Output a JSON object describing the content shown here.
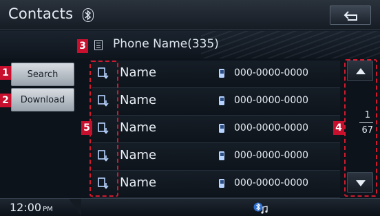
{
  "header": {
    "title": "Contacts",
    "back_label": "back"
  },
  "subbar": {
    "phone_name": "Phone Name(335)"
  },
  "badges": [
    "1",
    "2",
    "3",
    "4",
    "5"
  ],
  "side_buttons": {
    "search": "Search",
    "download": "Download"
  },
  "contacts": [
    {
      "name": "Name",
      "number": "000-0000-0000"
    },
    {
      "name": "Name",
      "number": "000-0000-0000"
    },
    {
      "name": "Name",
      "number": "000-0000-0000"
    },
    {
      "name": "Name",
      "number": "000-0000-0000"
    },
    {
      "name": "Name",
      "number": "000-0000-0000"
    }
  ],
  "pagination": {
    "current": "1",
    "total": "67"
  },
  "footer": {
    "time": "12:00",
    "ampm": "PM"
  },
  "icons": {
    "bluetooth": "bluetooth-icon",
    "back": "back-arrow-icon",
    "phonebook": "phonebook-icon",
    "download_contact": "contact-download-icon",
    "mobile": "mobile-phone-icon",
    "scroll_up": "triangle-up-icon",
    "scroll_down": "triangle-down-icon",
    "bt_audio": "bluetooth-audio-icon"
  },
  "colors": {
    "callout": "#d11a2e",
    "badge": "#c8102e",
    "mobile_icon": "#b7d3ff"
  }
}
